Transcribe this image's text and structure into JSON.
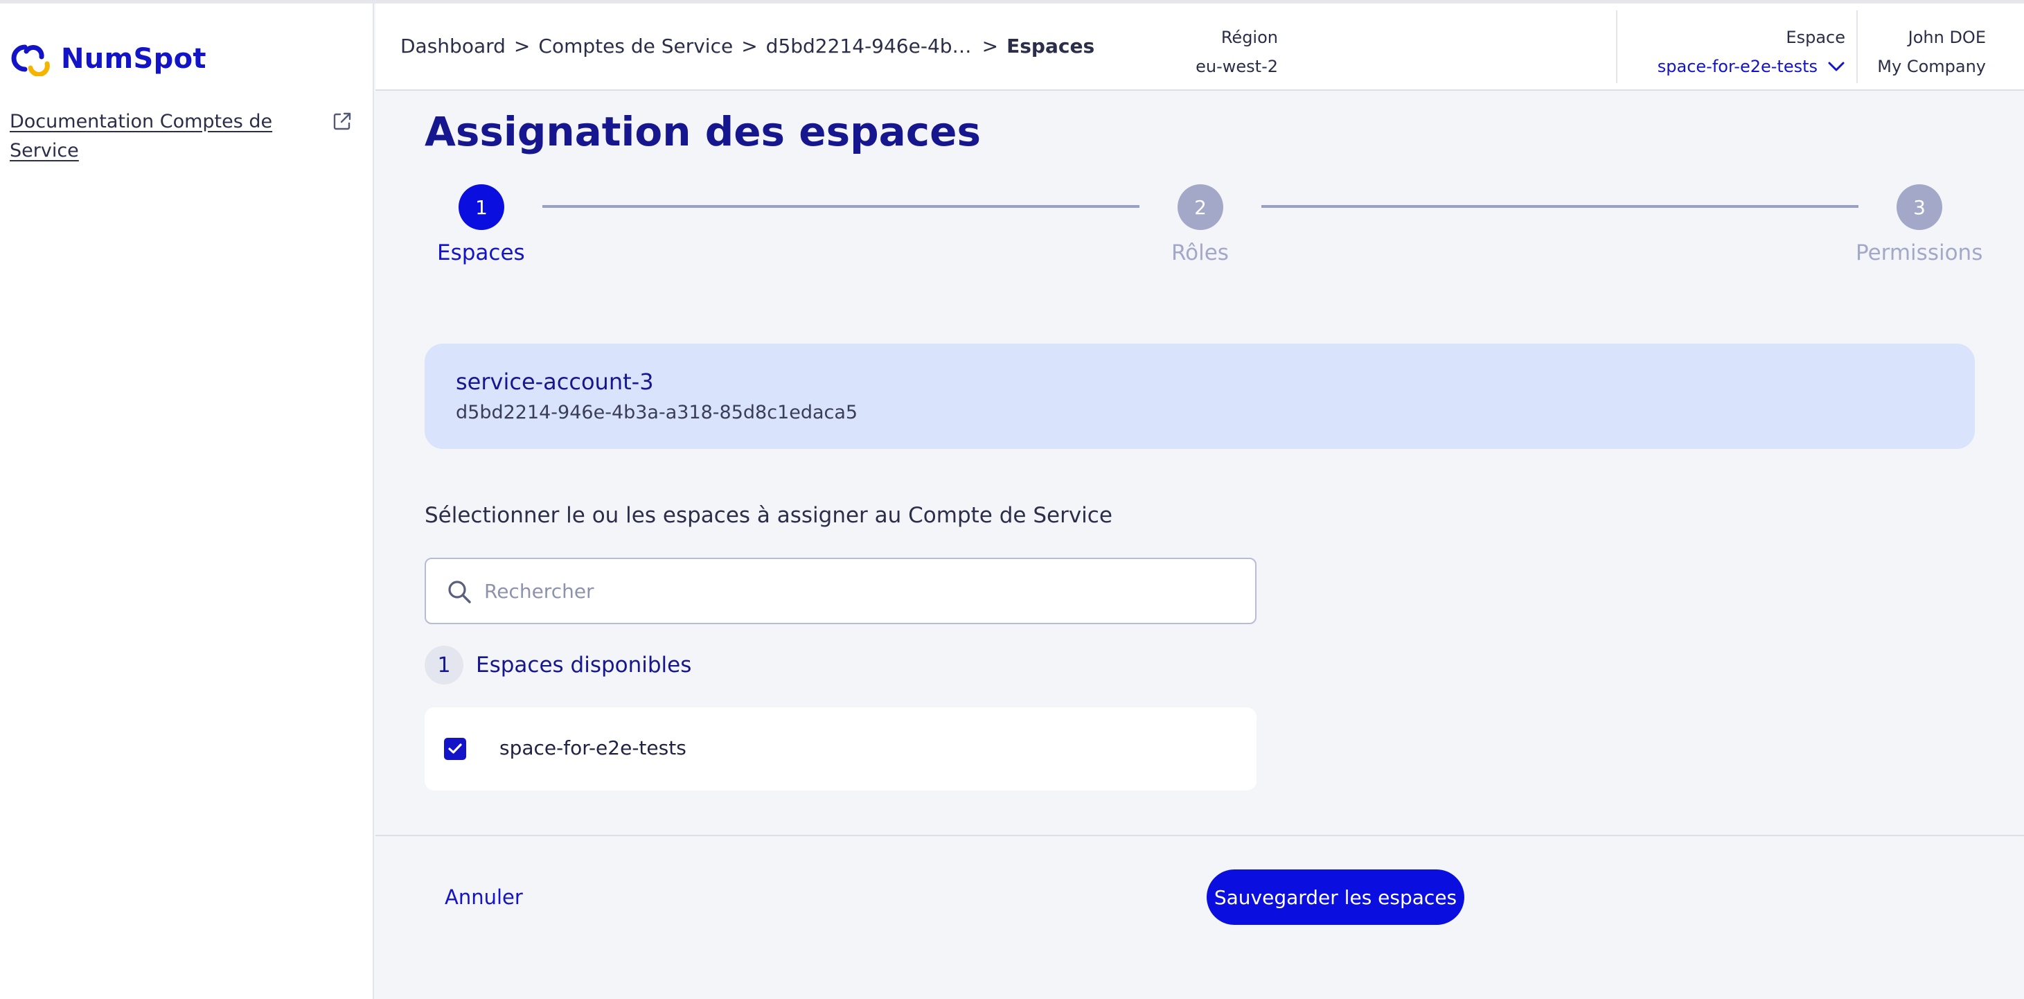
{
  "brand": {
    "name": "NumSpot",
    "color": "#1313c7",
    "accent": "#f4b400"
  },
  "sidebar": {
    "doc_link": "Documentation Comptes de Service"
  },
  "header": {
    "breadcrumb": [
      "Dashboard",
      "Comptes de Service",
      "d5bd2214-946e-4b3a-a318-85d8c1edaca5",
      "Espaces"
    ],
    "region_label": "Région",
    "region_value": "eu-west-2",
    "space_label": "Espace",
    "space_value": "space-for-e2e-tests",
    "user_name": "John DOE",
    "user_company": "My Company"
  },
  "page": {
    "title": "Assignation des espaces"
  },
  "stepper": {
    "current_step": 1,
    "steps": [
      {
        "number": "1",
        "label": "Espaces"
      },
      {
        "number": "2",
        "label": "Rôles"
      },
      {
        "number": "3",
        "label": "Permissions"
      }
    ]
  },
  "service_account": {
    "name": "service-account-3",
    "id": "d5bd2214-946e-4b3a-a318-85d8c1edaca5"
  },
  "selection": {
    "label": "Sélectionner le ou les espaces à assigner au Compte de Service",
    "search_placeholder": "Rechercher",
    "search_value": "",
    "available_count": "1",
    "available_label": "Espaces disponibles",
    "spaces": [
      {
        "name": "space-for-e2e-tests",
        "checked": true
      }
    ]
  },
  "actions": {
    "cancel_label": "Annuler",
    "save_label": "Sauvegarder les espaces"
  },
  "colors": {
    "primary": "#1313c7",
    "button": "#0a0fe0",
    "step_inactive": "#a3a8c9",
    "card_bg": "#d9e3fb"
  }
}
